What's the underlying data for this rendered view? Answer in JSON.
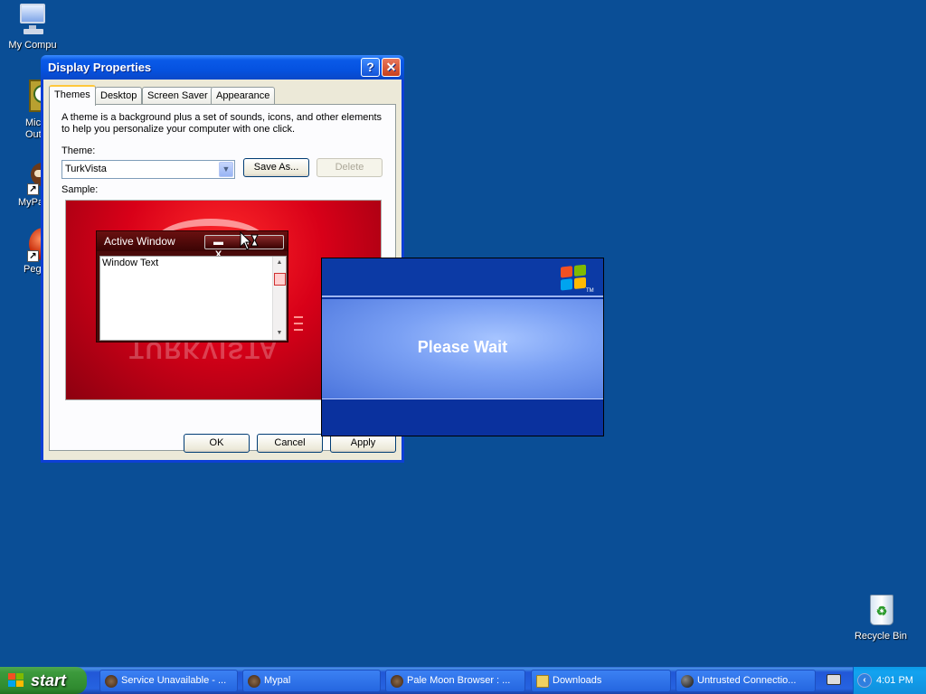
{
  "desktop": {
    "icons": [
      {
        "label": "My Compu"
      },
      {
        "label": "Micros Outlo"
      },
      {
        "label": "MyPa"
      },
      {
        "label": "Peg"
      },
      {
        "label": "Recycle Bin"
      }
    ]
  },
  "dialog": {
    "title": "Display Properties",
    "help": "?",
    "close": "✕",
    "tabs": [
      "Themes",
      "Desktop",
      "Screen Saver",
      "Appearance"
    ],
    "description": "A theme is a background plus a set of sounds, icons, and other elements to help you personalize your computer with one click.",
    "theme_label": "Theme:",
    "theme_value": "TurkVista",
    "save_as": "Save As...",
    "delete": "Delete",
    "sample_label": "Sample:",
    "sample": {
      "window_title": "Active Window",
      "window_text": "Window Text",
      "btn_min": "▬",
      "btn_max": "▭",
      "btn_close": "X",
      "brand": "TURKVISTA"
    },
    "ok": "OK",
    "cancel": "Cancel",
    "apply": "Apply"
  },
  "splash": {
    "message": "Please Wait",
    "tm": "TM"
  },
  "taskbar": {
    "start": "start",
    "tasks": [
      {
        "label": "Service Unavailable - ..."
      },
      {
        "label": "Mypal"
      },
      {
        "label": "Pale Moon Browser : ..."
      },
      {
        "label": "Downloads"
      },
      {
        "label": "Untrusted Connectio..."
      }
    ],
    "tray_chevron": "‹",
    "clock": "4:01 PM"
  },
  "colors": {
    "desktop": "#0a4e96",
    "accent_tab": "#ffc83c",
    "taskbar": "#2663e0",
    "start": "#3c9a3c"
  }
}
